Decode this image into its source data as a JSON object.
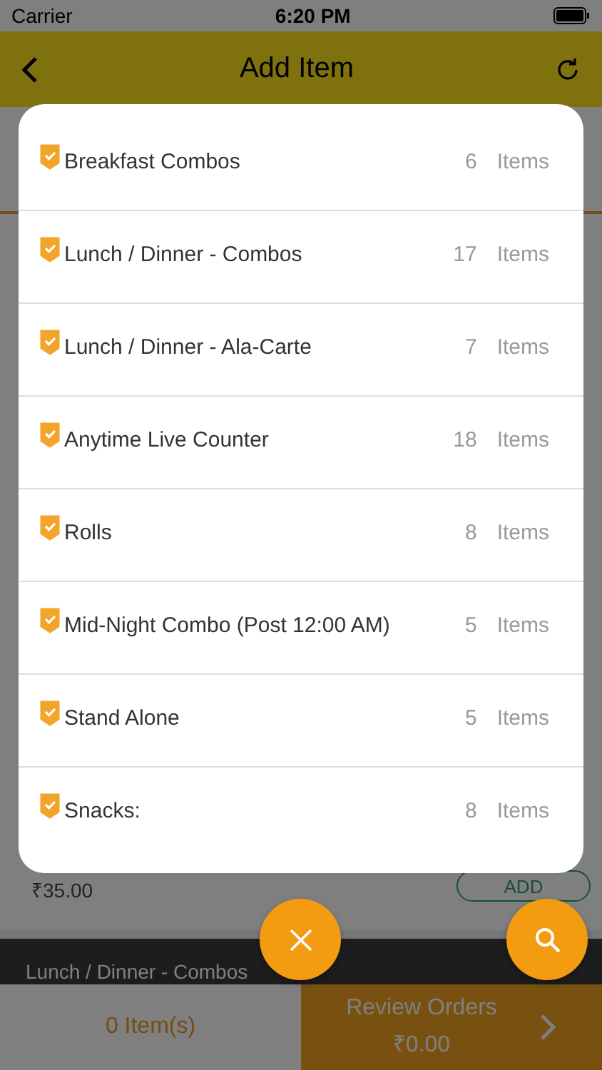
{
  "status_bar": {
    "carrier": "Carrier",
    "time": "6:20 PM"
  },
  "header": {
    "title": "Add Item"
  },
  "background_list": {
    "price": "₹35.00",
    "add_label": "ADD",
    "next_category": "Lunch / Dinner - Combos"
  },
  "categories": [
    {
      "name": "Breakfast Combos",
      "count": "6",
      "unit": "Items",
      "checked": true
    },
    {
      "name": "Lunch / Dinner - Combos",
      "count": "17",
      "unit": "Items",
      "checked": true
    },
    {
      "name": "Lunch / Dinner - Ala-Carte",
      "count": "7",
      "unit": "Items",
      "checked": true
    },
    {
      "name": "Anytime Live Counter",
      "count": "18",
      "unit": "Items",
      "checked": true
    },
    {
      "name": "Rolls",
      "count": "8",
      "unit": "Items",
      "checked": true
    },
    {
      "name": "Mid-Night Combo (Post 12:00 AM)",
      "count": "5",
      "unit": "Items",
      "checked": true
    },
    {
      "name": "Stand Alone",
      "count": "5",
      "unit": "Items",
      "checked": true
    },
    {
      "name": "Snacks:",
      "count": "8",
      "unit": "Items",
      "checked": true
    }
  ],
  "bottom_bar": {
    "count": "0 Item(s)",
    "review_label": "Review Orders",
    "total": "₹0.00"
  }
}
